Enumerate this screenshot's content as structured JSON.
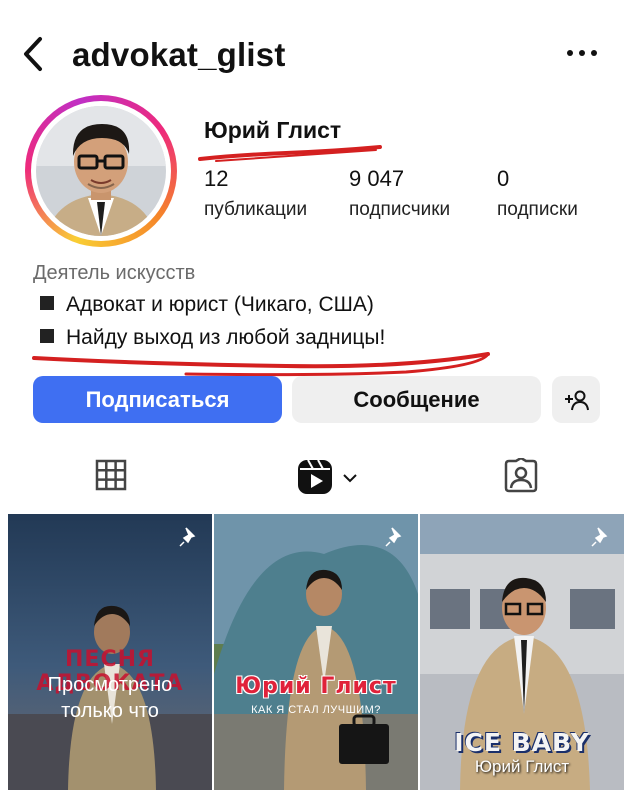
{
  "header": {
    "username": "advokat_glist",
    "back_icon": "chevron-left-icon",
    "more_icon": "more-dots-icon"
  },
  "profile": {
    "full_name": "Юрий Глист",
    "stats": [
      {
        "value": "12",
        "label": "публикации"
      },
      {
        "value": "9 047",
        "label": "подписчики"
      },
      {
        "value": "0",
        "label": "подписки"
      }
    ],
    "category": "Деятель искусств",
    "bio": [
      "Адвокат и юрист (Чикаго, США)",
      "Найду выход из любой задницы!"
    ],
    "annotation_color": "#d42020"
  },
  "actions": {
    "follow_label": "Подписаться",
    "message_label": "Сообщение",
    "follow_color": "#3f6ff2"
  },
  "tabs": [
    "grid-icon",
    "reels-icon",
    "tagged-icon"
  ],
  "posts": [
    {
      "pinned": true,
      "title": "ПЕСНЯ АДВОКАТА",
      "overlay_lines": [
        "Просмотрено",
        "только что"
      ]
    },
    {
      "pinned": true,
      "title": "Юрий Глист",
      "subtitle": "КАК Я СТАЛ ЛУЧШИМ?"
    },
    {
      "pinned": true,
      "title": "ICE BABY",
      "subtitle": "Юрий Глист"
    }
  ]
}
